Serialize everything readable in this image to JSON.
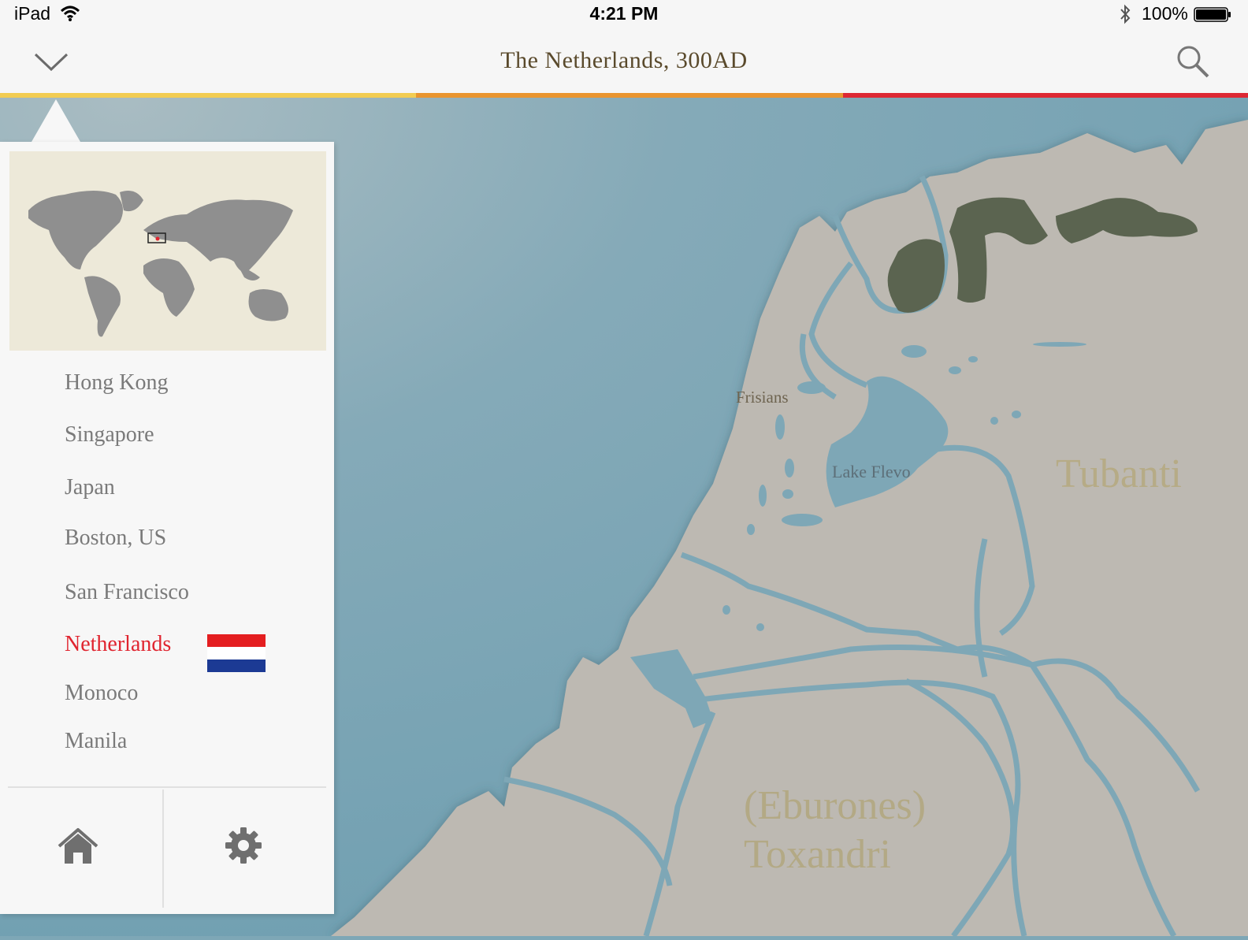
{
  "status_bar": {
    "device": "iPad",
    "time": "4:21 PM",
    "battery": "100%",
    "icons": [
      "wifi-icon",
      "bluetooth-icon",
      "battery-icon"
    ]
  },
  "nav": {
    "title": "The Netherlands, 300AD",
    "icons": [
      "chevron-down-icon",
      "search-icon"
    ]
  },
  "colors": {
    "accent_active": "#e0242f",
    "stripe": [
      "#f2cc52",
      "#e9952f",
      "#dd2833"
    ],
    "sea": "#7ea7b6",
    "land": "#bdb9b2",
    "forest": "#5b6450"
  },
  "map": {
    "labels": {
      "frisians": "Frisians",
      "lake_flevo": "Lake Flevo",
      "tubanti": "Tubanti",
      "eburones": "(Eburones)",
      "toxandri": "Toxandri"
    }
  },
  "sidebar": {
    "cities": [
      {
        "label": "Hong Kong"
      },
      {
        "label": "Singapore"
      },
      {
        "label": "Japan"
      },
      {
        "label": "Boston, US"
      },
      {
        "label": "San Francisco"
      },
      {
        "label": "Netherlands",
        "active": true
      },
      {
        "label": "Monoco"
      },
      {
        "label": "Manila"
      }
    ],
    "bottom_icons": [
      "home-icon",
      "gear-icon"
    ]
  }
}
